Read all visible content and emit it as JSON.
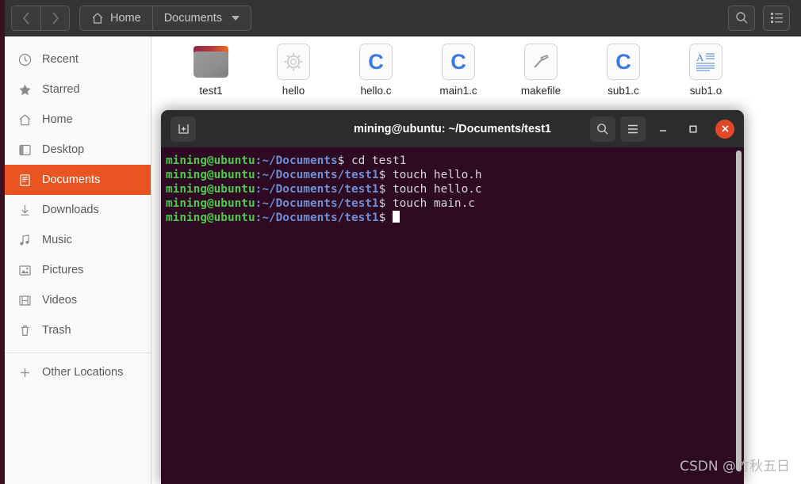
{
  "header": {
    "nav_back_label": "‹",
    "nav_forward_label": "›",
    "breadcrumbs": [
      {
        "label": "Home",
        "icon": "home-icon"
      },
      {
        "label": "Documents",
        "icon": "chevron-down-icon"
      }
    ],
    "search_icon": "search-icon",
    "view_list_icon": "list-view-icon"
  },
  "sidebar": {
    "items": [
      {
        "label": "Recent",
        "icon": "clock-icon",
        "active": false
      },
      {
        "label": "Starred",
        "icon": "star-icon",
        "active": false
      },
      {
        "label": "Home",
        "icon": "home-icon",
        "active": false
      },
      {
        "label": "Desktop",
        "icon": "desktop-icon",
        "active": false
      },
      {
        "label": "Documents",
        "icon": "documents-icon",
        "active": true
      },
      {
        "label": "Downloads",
        "icon": "download-icon",
        "active": false
      },
      {
        "label": "Music",
        "icon": "music-icon",
        "active": false
      },
      {
        "label": "Pictures",
        "icon": "picture-icon",
        "active": false
      },
      {
        "label": "Videos",
        "icon": "video-icon",
        "active": false
      },
      {
        "label": "Trash",
        "icon": "trash-icon",
        "active": false
      }
    ],
    "other_locations": {
      "label": "Other Locations",
      "icon": "plus-icon"
    },
    "active_color": "#e95420"
  },
  "files": [
    {
      "name": "test1",
      "icon": "folder-icon"
    },
    {
      "name": "hello",
      "icon": "executable-gear-icon"
    },
    {
      "name": "hello.c",
      "icon": "c-source-icon"
    },
    {
      "name": "main1.c",
      "icon": "c-source-icon"
    },
    {
      "name": "makefile",
      "icon": "makefile-hammer-icon"
    },
    {
      "name": "sub1.c",
      "icon": "c-source-icon"
    },
    {
      "name": "sub1.o",
      "icon": "text-document-icon"
    }
  ],
  "terminal": {
    "title": "mining@ubuntu: ~/Documents/test1",
    "new_tab_icon": "new-tab-icon",
    "search_icon": "search-icon",
    "menu_icon": "hamburger-menu-icon",
    "minimize_icon": "minimize-icon",
    "maximize_icon": "maximize-icon",
    "close_icon": "close-icon",
    "background_color": "#2d0922",
    "prompt_user_color": "#4ec94e",
    "prompt_path_color": "#6e8fd4",
    "lines": [
      {
        "user": "mining@ubuntu",
        "sep": ":",
        "path": "~/Documents",
        "dollar": "$",
        "command": " cd test1"
      },
      {
        "user": "mining@ubuntu",
        "sep": ":",
        "path": "~/Documents/test1",
        "dollar": "$",
        "command": " touch hello.h"
      },
      {
        "user": "mining@ubuntu",
        "sep": ":",
        "path": "~/Documents/test1",
        "dollar": "$",
        "command": " touch hello.c"
      },
      {
        "user": "mining@ubuntu",
        "sep": ":",
        "path": "~/Documents/test1",
        "dollar": "$",
        "command": " touch main.c"
      },
      {
        "user": "mining@ubuntu",
        "sep": ":",
        "path": "~/Documents/test1",
        "dollar": "$",
        "command": " "
      }
    ]
  },
  "watermark": {
    "text": "CSDN @竹秋五日"
  }
}
